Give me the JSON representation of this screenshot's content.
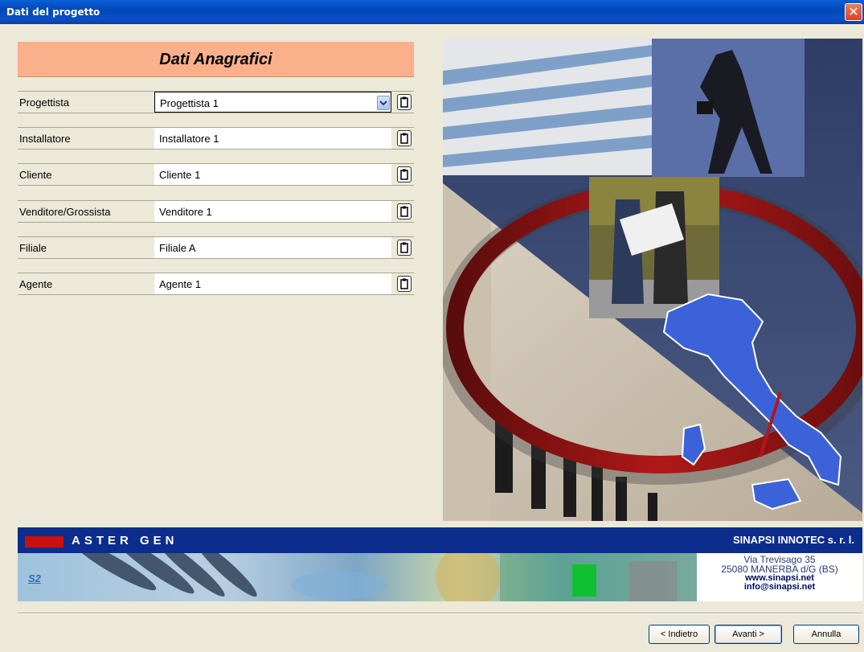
{
  "window": {
    "title": "Dati del progetto",
    "close_glyph": "✕"
  },
  "header": {
    "title": "Dati Anagrafici"
  },
  "fields": [
    {
      "label": "Progettista",
      "value": "Progettista 1",
      "control": "combo"
    },
    {
      "label": "Installatore",
      "value": "Installatore 1",
      "control": "text"
    },
    {
      "label": "Cliente",
      "value": "Cliente 1",
      "control": "text"
    },
    {
      "label": "Venditore/Grossista",
      "value": "Venditore 1",
      "control": "text"
    },
    {
      "label": "Filiale",
      "value": "Filiale A",
      "control": "text"
    },
    {
      "label": "Agente",
      "value": "Agente 1",
      "control": "text"
    }
  ],
  "banner": {
    "product": "ASTER GEN",
    "company": "SINAPSI INNOTEC s. r. l.",
    "logo_text": "S2",
    "address1": "Via Trevisago 35",
    "address2": "25080 MANERBA d/G (BS)",
    "web": "www.sinapsi.net",
    "email": "info@sinapsi.net"
  },
  "buttons": {
    "back": "< Indietro",
    "next": "Avanti >",
    "cancel": "Annulla"
  },
  "icons": {
    "field_action": "clipboard-icon",
    "combo": "chevron-down-icon",
    "close": "close-icon"
  }
}
